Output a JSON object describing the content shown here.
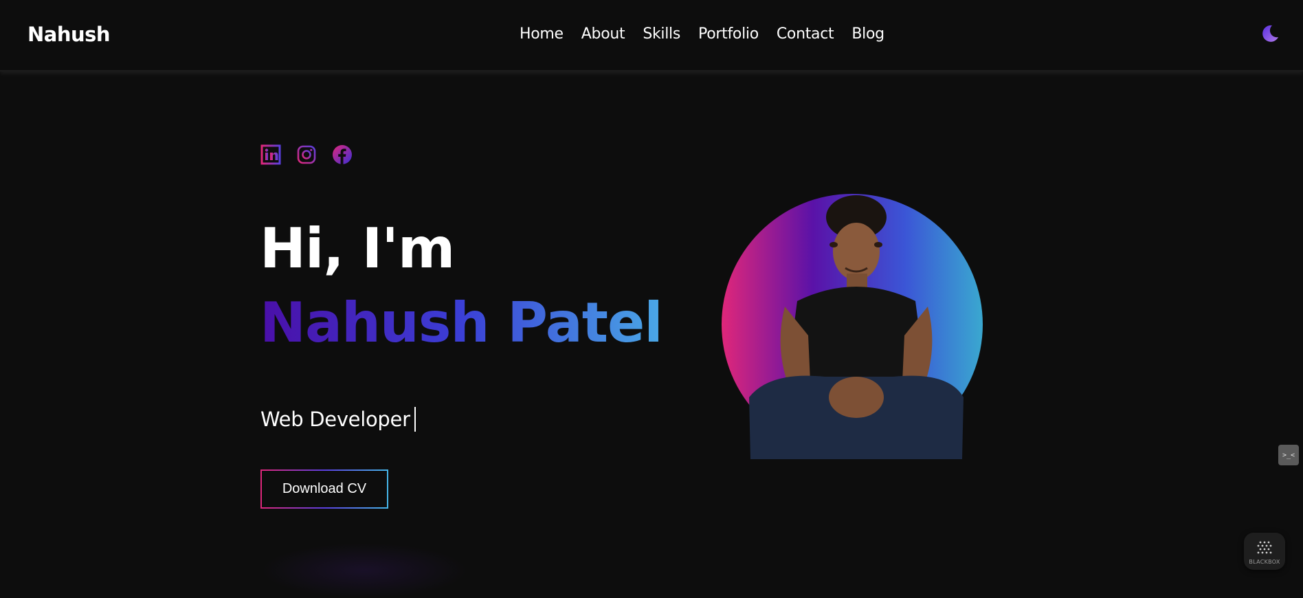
{
  "navbar": {
    "logo": "Nahush",
    "links": [
      "Home",
      "About",
      "Skills",
      "Portfolio",
      "Contact",
      "Blog"
    ],
    "theme_icon": "moon-icon"
  },
  "hero": {
    "social_icons": [
      "linkedin-icon",
      "instagram-icon",
      "facebook-icon"
    ],
    "greeting": "Hi, I'm",
    "name": "Nahush Patel",
    "role": "Web Developer",
    "cv_button": "Download CV"
  },
  "widgets": {
    "side_button": ">_<",
    "blackbox_label": "BLACKBOX"
  },
  "colors": {
    "background": "#0d0d0d",
    "gradient_pink": "#e0277a",
    "gradient_purple": "#5a12a8",
    "gradient_blue": "#3b3fd6",
    "gradient_cyan": "#46b6e8"
  }
}
